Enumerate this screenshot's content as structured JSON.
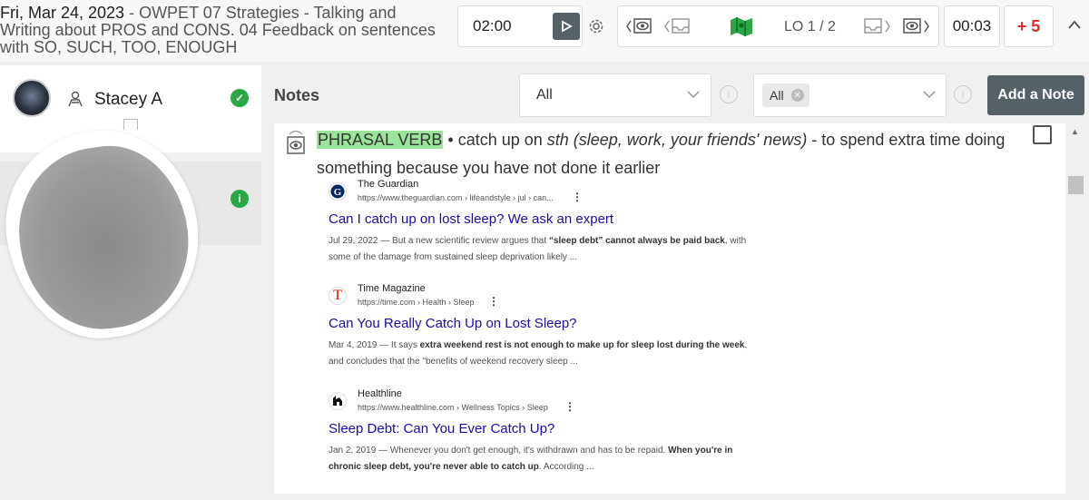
{
  "header": {
    "date": "Fri, Mar 24, 2023",
    "lesson_title": "OWPET 07 Strategies - Talking and Writing about PROS and CONS. 04 Feedback on sentences with SO, SUCH, TOO, ENOUGH",
    "timer": "02:00",
    "lo_label": "LO 1 / 2",
    "elapsed": "00:03",
    "score": "+ 5",
    "accent_green": "#2aa745",
    "score_color": "#e02b2b"
  },
  "sidebar": {
    "students": [
      {
        "name": "Stacey A",
        "status": "check"
      },
      {
        "name": "",
        "status": "info"
      }
    ]
  },
  "toolbar": {
    "notes_label": "Notes",
    "filter1_value": "All",
    "filter2_tag": "All",
    "add_note_label": "Add a Note"
  },
  "note": {
    "tag": "PHRASAL VERB",
    "bullet": " • catch up on ",
    "sth": "sth",
    "context": "  (sleep, work, your friends' news)",
    "definition": " - to spend extra time doing something because you have not done it earlier"
  },
  "results": [
    {
      "source": "The Guardian",
      "url": "https://www.theguardian.com › lifeandstyle › jul › can...",
      "title": "Can I catch up on lost sleep? We ask an expert",
      "date": "Jul 29, 2022",
      "snip_a": " — But a new scientific review argues that ",
      "snip_b": "“sleep debt” cannot always be paid back",
      "snip_c": ", with some of the damage from sustained sleep deprivation likely ..."
    },
    {
      "source": "Time Magazine",
      "url": "https://time.com › Health › Sleep",
      "title": "Can You Really Catch Up on Lost Sleep?",
      "date": "Mar 4, 2019",
      "snip_a": " — It says ",
      "snip_b": "extra weekend rest is not enough to make up for sleep lost during the week",
      "snip_c": ", and concludes that the \"benefits of weekend recovery sleep ..."
    },
    {
      "source": "Healthline",
      "url": "https://www.healthline.com › Wellness Topics › Sleep",
      "title": "Sleep Debt: Can You Ever Catch Up?",
      "date": "Jan 2, 2019",
      "snip_a": " — Whenever you don't get enough, it's withdrawn and has to be repaid. ",
      "snip_b": "When you're in chronic sleep debt, you're never able to catch up",
      "snip_c": ". According ..."
    }
  ]
}
